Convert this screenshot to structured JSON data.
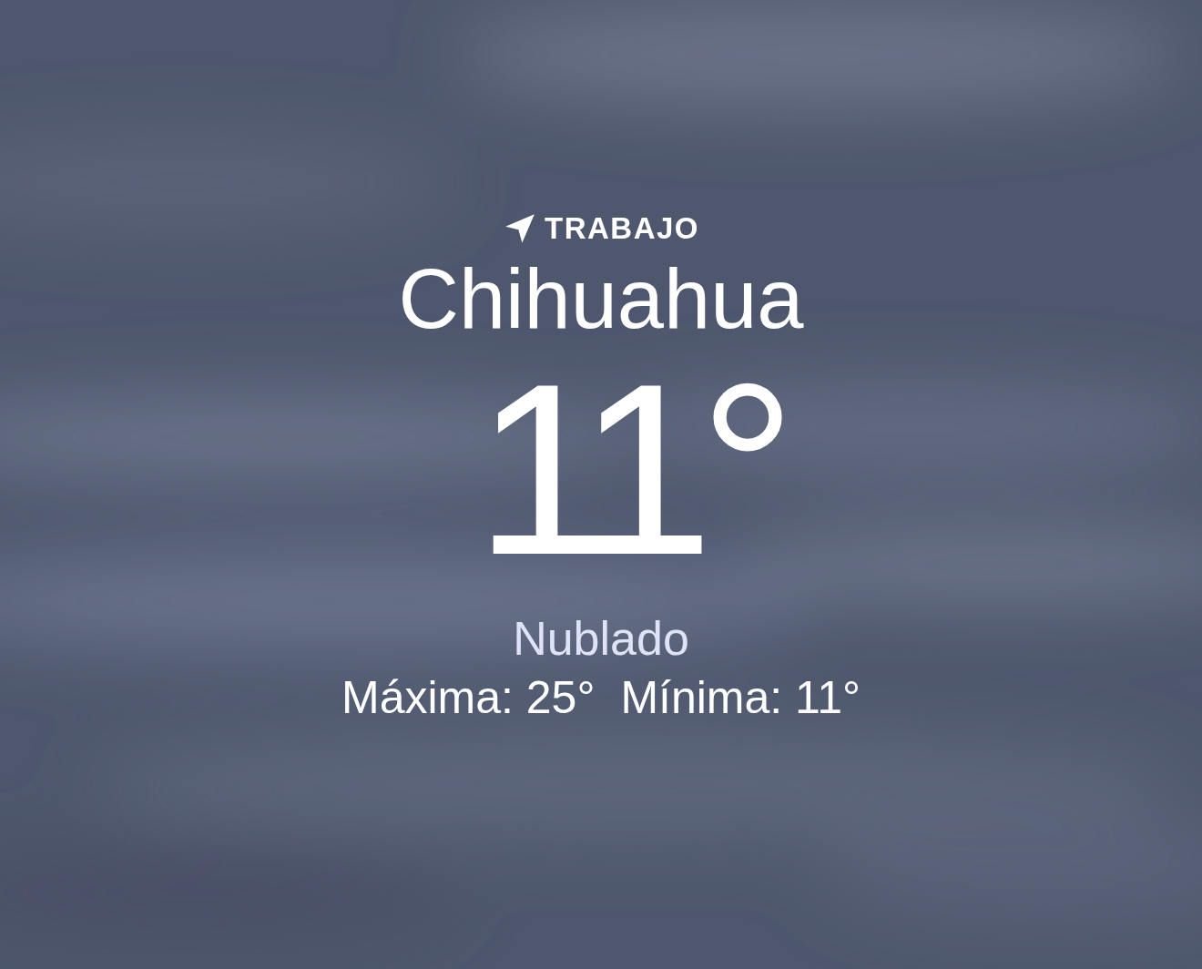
{
  "location": {
    "label": "TRABAJO"
  },
  "city": "Chihuahua",
  "temperature": "11°",
  "condition": "Nublado",
  "high": "Máxima: 25°",
  "low": "Mínima: 11°"
}
